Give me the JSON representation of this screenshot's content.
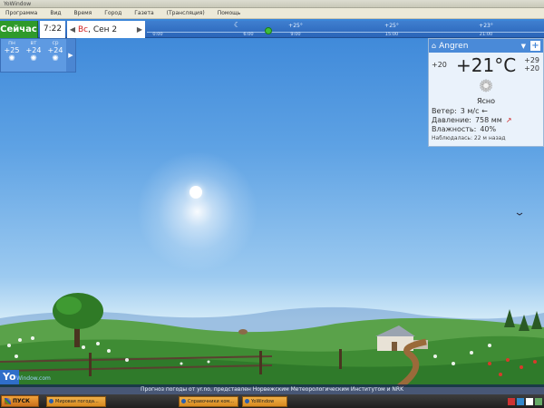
{
  "window": {
    "title": "YoWindow"
  },
  "menu": [
    "Программа",
    "Вид",
    "Время",
    "Город",
    "Газета",
    "(Трансляция)",
    "Помощь"
  ],
  "timebar": {
    "now_label": "Сейчас",
    "time": "7:22",
    "date_dow": "Вс",
    "date_rest": ", Сен 2",
    "ticks": [
      "0:00",
      "6:00",
      "9:00",
      "15:00",
      "21:00"
    ],
    "temps": [
      "+25°",
      "+25°",
      "+23°"
    ]
  },
  "forecast": [
    {
      "day": "пн",
      "temp": "+25",
      "icon": "sun-icon"
    },
    {
      "day": "вт",
      "temp": "+24",
      "icon": "sun-icon"
    },
    {
      "day": "ср",
      "temp": "+24",
      "icon": "sun-icon"
    }
  ],
  "current": {
    "city": "Angren",
    "small_temp": "+20",
    "temp": "+21°C",
    "hi": "+29",
    "lo": "+20",
    "condition": "Ясно",
    "wind_label": "Ветер:",
    "wind_value": "3 м/с ←",
    "pressure_label": "Давление:",
    "pressure_value": "758 мм",
    "humidity_label": "Влажность:",
    "humidity_value": "40%",
    "observed": "Наблюдалась: 22 м назад"
  },
  "brand": {
    "logo": "Yo",
    "small": "Window.com"
  },
  "footer": "Прогноз погоды от yr.no, представлен Норвежским Метеорологическим Институтом и NRK",
  "taskbar": {
    "start": "ПУСК",
    "tasks": [
      "Мировая погода...",
      "Справочники ком...",
      "YoWindow"
    ]
  },
  "colors": {
    "accent": "#2f9a2a",
    "sky_top": "#3b86d8",
    "panel_header": "#4a8ad8"
  }
}
